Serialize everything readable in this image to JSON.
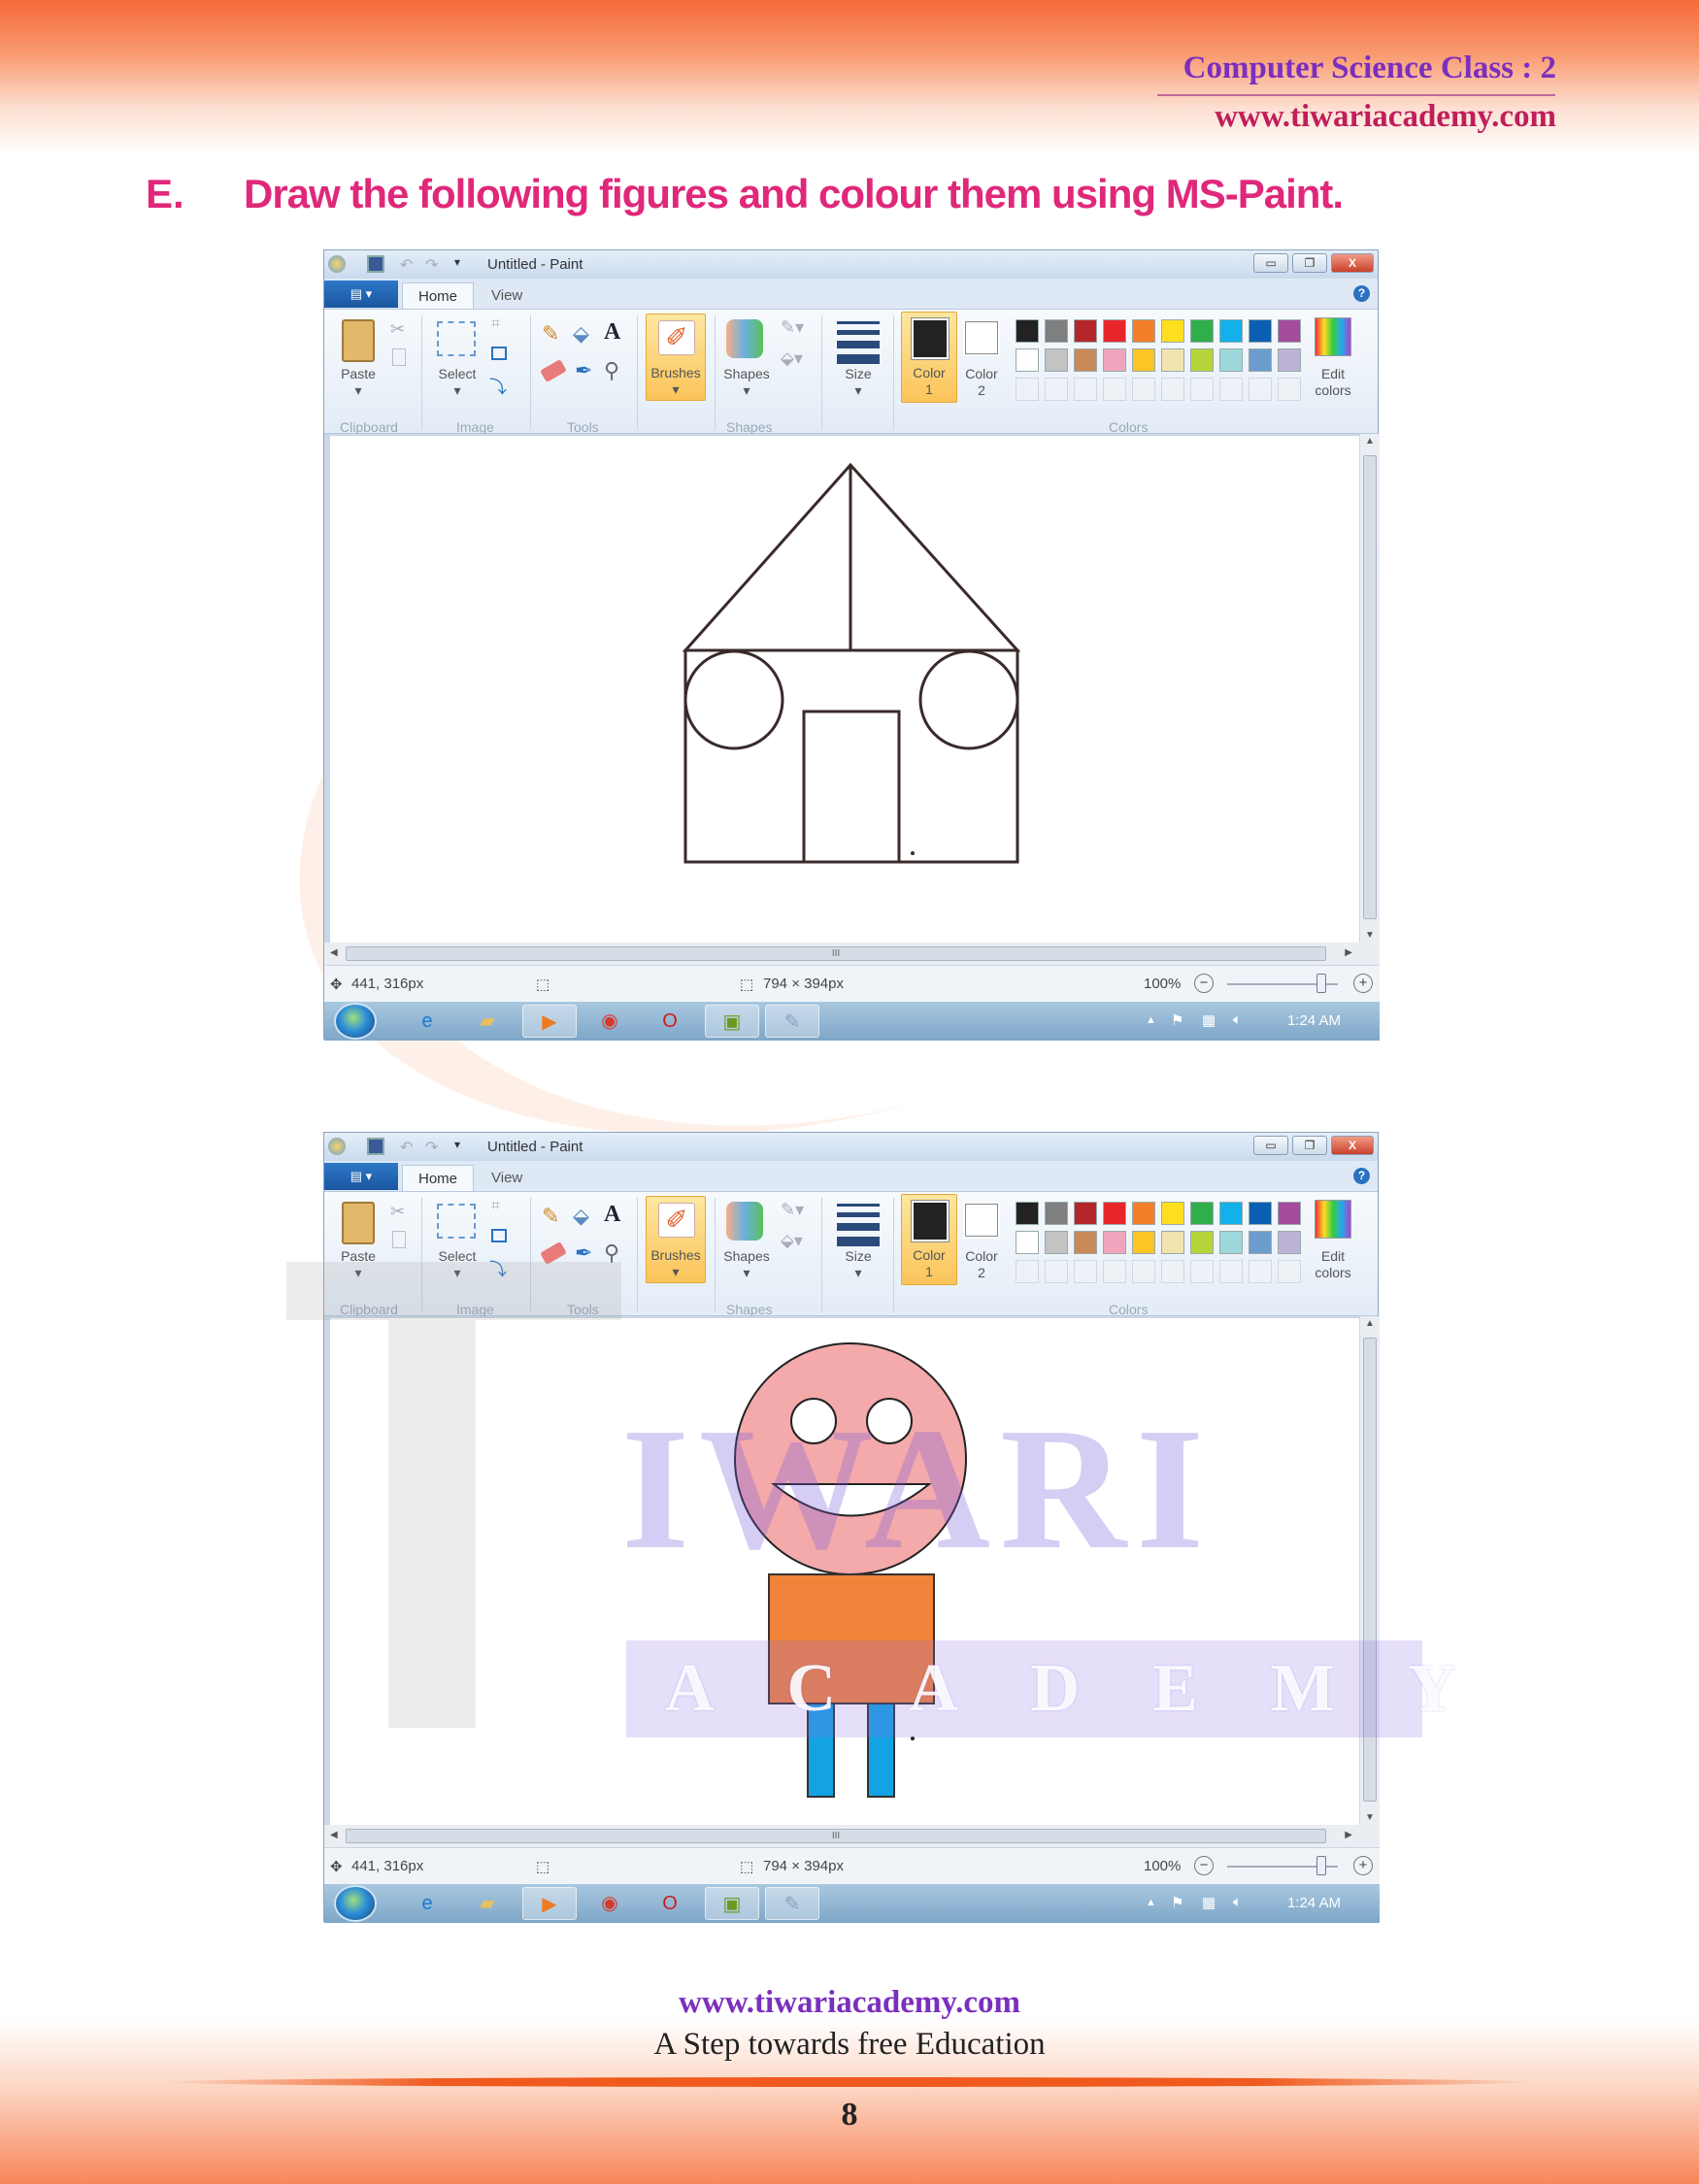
{
  "header": {
    "class_label": "Computer Science Class : 2",
    "website": "www.tiwariacademy.com"
  },
  "question": {
    "letter": "E.",
    "text": "Draw the following figures and colour them using MS-Paint."
  },
  "watermark": {
    "brand": "IWARI",
    "subbrand": "ACADEMY"
  },
  "paint": {
    "title": "Untitled - Paint",
    "file_menu": "▤ ▾",
    "tabs": [
      {
        "label": "Home",
        "active": true
      },
      {
        "label": "View",
        "active": false
      }
    ],
    "ribbon": {
      "paste": "Paste",
      "select": "Select",
      "brushes": "Brushes",
      "shapes": "Shapes",
      "size": "Size",
      "color1": "Color",
      "color1_num": "1",
      "color2": "Color",
      "color2_num": "2",
      "edit_colors": "Edit",
      "edit_colors2": "colors",
      "groups": [
        "Clipboard",
        "Image",
        "Tools",
        "Shapes",
        "Colors"
      ]
    },
    "palette": [
      "#222222",
      "#7f7f7f",
      "#b5262a",
      "#e8262a",
      "#f47e2a",
      "#fddf20",
      "#2fae4a",
      "#13b0ea",
      "#0a5fb0",
      "#a44b9c",
      "#ffffff",
      "#c3c3c3",
      "#c98a5a",
      "#f1a5bd",
      "#fcc425",
      "#f1e4b0",
      "#b5d53a",
      "#9ed8dc",
      "#6c9ccb",
      "#bcb3d6"
    ],
    "color1_value": "#222222",
    "color2_value": "#ffffff",
    "status": {
      "cursor": "441, 316px",
      "canvas_size": "794 × 394px",
      "zoom": "100%",
      "zoom_level_percent": 100
    },
    "taskbar": {
      "clock": "1:24 AM"
    }
  },
  "drawings": {
    "house_stroke": "#3a2a2a",
    "face_fill": "#f4a9ab",
    "body_fill": "#f0823a",
    "legs_fill": "#13a2e4"
  },
  "footer": {
    "website": "www.tiwariacademy.com",
    "tagline": "A Step towards free Education",
    "page_number": "8"
  }
}
